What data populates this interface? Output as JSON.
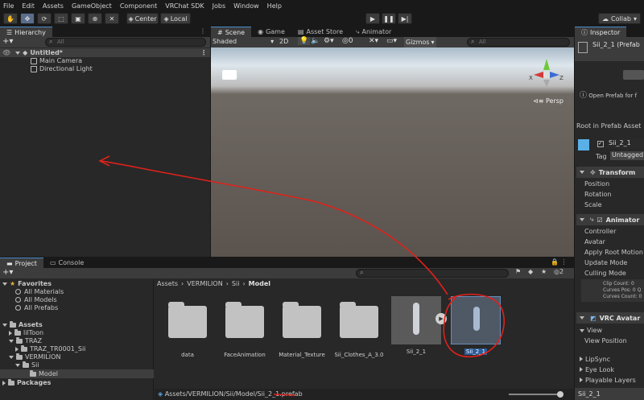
{
  "menu": [
    "File",
    "Edit",
    "Assets",
    "GameObject",
    "Component",
    "VRChat SDK",
    "Jobs",
    "Window",
    "Help"
  ],
  "toolbar": {
    "center_label": "Center",
    "local_label": "Local",
    "collab_label": "Collab"
  },
  "hierarchy": {
    "tab_label": "Hierarchy",
    "search_placeholder": "All",
    "scene_name": "Untitled*",
    "items": [
      "Main Camera",
      "Directional Light"
    ]
  },
  "scene": {
    "tabs": [
      "Scene",
      "Game",
      "Asset Store",
      "Animator"
    ],
    "shading": "Shaded",
    "mode_2d": "2D",
    "gizmos_label": "Gizmos",
    "search_placeholder": "All",
    "persp_label": "Persp",
    "gizmo_axes": {
      "x": "X",
      "z": "Z"
    }
  },
  "project": {
    "tabs": [
      "Project",
      "Console"
    ],
    "favorites_label": "Favorites",
    "favorites": [
      "All Materials",
      "All Models",
      "All Prefabs"
    ],
    "assets_label": "Assets",
    "tree": [
      "lilToon",
      "TRAZ",
      "TRAZ_TR0001_Sii",
      "VERMILION",
      "Sii",
      "Model"
    ],
    "packages_label": "Packages",
    "breadcrumb": [
      "Assets",
      "VERMILION",
      "Sii",
      "Model"
    ],
    "grid": [
      "data",
      "FaceAnimation",
      "Material_Texture",
      "Sii_Clothes_A_3.0",
      "Sii_2_1",
      "Sii_2_1"
    ],
    "status_path": "Assets/VERMILION/Sii/Model/Sii_2_1.prefab",
    "hidden_count": "2"
  },
  "inspector": {
    "tab_label": "Inspector",
    "title": "Sii_2_1 (Prefab",
    "open_prefab": "Open Prefab for f",
    "root_label": "Root in Prefab Asset",
    "object_name": "Sii_2_1",
    "tag_label": "Tag",
    "tag_value": "Untagged",
    "transform_label": "Transform",
    "transform_fields": [
      "Position",
      "Rotation",
      "Scale"
    ],
    "animator_label": "Animator",
    "animator_fields": [
      "Controller",
      "Avatar",
      "Apply Root Motion",
      "Update Mode",
      "Culling Mode"
    ],
    "clip_info": [
      "Clip Count: 0",
      "Curves Pos: 0 Q",
      "Curves Count: 0"
    ],
    "vrc_label": "VRC Avatar",
    "vrc_fields": [
      "View",
      "View Position",
      "LipSync",
      "Eye Look",
      "Playable Layers"
    ],
    "footer": "Sii_2_1"
  },
  "colors": {
    "accent": "#4a8cd0",
    "annotation": "#e0211b",
    "sky": "#c9d9e6",
    "ground": "#5b534d"
  }
}
